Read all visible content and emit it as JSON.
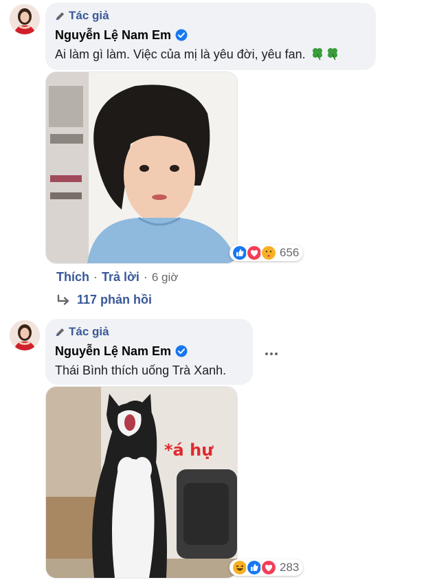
{
  "comments": [
    {
      "badge": "Tác giả",
      "author": "Nguyễn Lệ Nam Em",
      "text": "Ai làm gì làm. Việc của mị là yêu đời, yêu fan.",
      "text_emoji": "four-leaf-clover x2",
      "reaction_icons": [
        "like-icon",
        "love-icon",
        "care-icon"
      ],
      "reaction_count": "656",
      "actions": {
        "like": "Thích",
        "reply": "Trả lời",
        "separator": "·",
        "time": "6 giờ"
      },
      "replies_label": "117 phản hồi"
    },
    {
      "badge": "Tác giả",
      "author": "Nguyễn Lệ Nam Em",
      "text": "Thái Bình thích uống Trà Xanh.",
      "reaction_icons": [
        "haha-icon",
        "like-icon",
        "love-icon"
      ],
      "reaction_count": "283",
      "image_caption": "*á hự"
    }
  ],
  "colors": {
    "link": "#385898",
    "bubble_bg": "#f0f2f5",
    "meta_gray": "#65676b",
    "verified_blue": "#1877f2"
  }
}
